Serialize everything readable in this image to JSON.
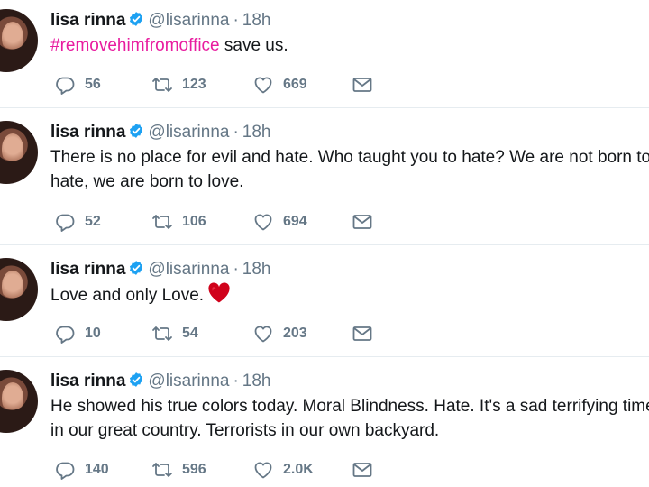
{
  "tweets": [
    {
      "name": "lisa rinna",
      "handle": "@lisarinna",
      "sep": "·",
      "time": "18h",
      "hashtag": "#removehimfromoffice",
      "line1": " save us.",
      "line2": "",
      "replies": "56",
      "retweets": "123",
      "likes": "669"
    },
    {
      "name": "lisa rinna",
      "handle": "@lisarinna",
      "sep": "·",
      "time": "18h",
      "hashtag": "",
      "line1": "There is no place for evil and hate. Who taught you to hate? We are not born to",
      "line2": "hate, we are born to love.",
      "replies": "52",
      "retweets": "106",
      "likes": "694"
    },
    {
      "name": "lisa rinna",
      "handle": "@lisarinna",
      "sep": "·",
      "time": "18h",
      "hashtag": "",
      "line1": "Love and only Love.",
      "line2": "",
      "emoji": "red-heart",
      "replies": "10",
      "retweets": "54",
      "likes": "203"
    },
    {
      "name": "lisa rinna",
      "handle": "@lisarinna",
      "sep": "·",
      "time": "18h",
      "hashtag": "",
      "line1": "He showed his true colors today. Moral Blindness. Hate. It's a sad terrifying time",
      "line2": "in our great country. Terrorists in our own backyard.",
      "replies": "140",
      "retweets": "596",
      "likes": "2.0K"
    }
  ],
  "colors": {
    "hashtag": "#e81c9f",
    "muted": "#657786",
    "verified": "#1da1f2",
    "divider": "#e6ecf0",
    "emoji_heart": "#d0021b"
  },
  "icons": [
    "verified-badge-icon",
    "reply-icon",
    "retweet-icon",
    "like-icon",
    "direct-message-icon"
  ]
}
